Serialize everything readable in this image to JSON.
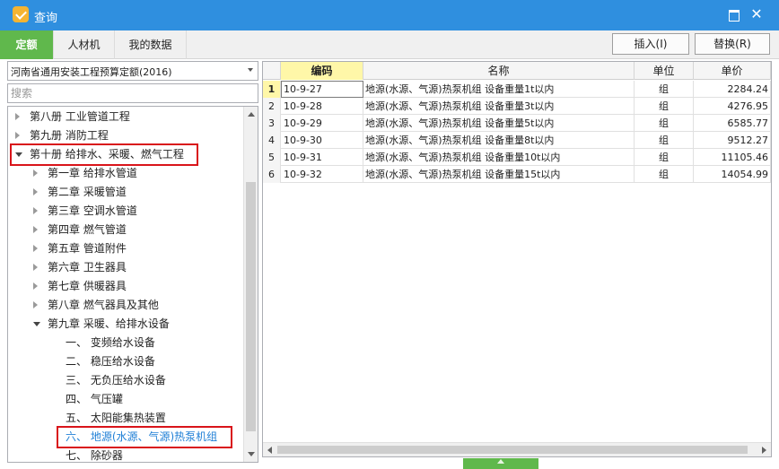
{
  "window": {
    "title": "查询",
    "maximize_glyph": "",
    "close_glyph": "✕",
    "icon": "check-icon",
    "accent_color": "#2f8fdf"
  },
  "tabs": [
    {
      "label": "定额",
      "active": true
    },
    {
      "label": "人材机",
      "active": false
    },
    {
      "label": "我的数据",
      "active": false
    }
  ],
  "toolbar": {
    "insert_label": "插入(I)",
    "replace_label": "替换(R)"
  },
  "left": {
    "dataset": "河南省通用安装工程预算定额(2016)",
    "search_placeholder": "搜索",
    "tree": [
      {
        "label": "第八册 工业管道工程",
        "level": 0,
        "state": "collapsed"
      },
      {
        "label": "第九册 消防工程",
        "level": 0,
        "state": "collapsed"
      },
      {
        "label": "第十册 给排水、采暖、燃气工程",
        "level": 0,
        "state": "expanded",
        "boxed": true
      },
      {
        "label": "第一章 给排水管道",
        "level": 1,
        "state": "collapsed"
      },
      {
        "label": "第二章 采暖管道",
        "level": 1,
        "state": "collapsed"
      },
      {
        "label": "第三章 空调水管道",
        "level": 1,
        "state": "collapsed"
      },
      {
        "label": "第四章 燃气管道",
        "level": 1,
        "state": "collapsed"
      },
      {
        "label": "第五章 管道附件",
        "level": 1,
        "state": "collapsed"
      },
      {
        "label": "第六章 卫生器具",
        "level": 1,
        "state": "collapsed"
      },
      {
        "label": "第七章 供暖器具",
        "level": 1,
        "state": "collapsed"
      },
      {
        "label": "第八章 燃气器具及其他",
        "level": 1,
        "state": "collapsed"
      },
      {
        "label": "第九章 采暖、给排水设备",
        "level": 1,
        "state": "expanded"
      },
      {
        "label": "一、 变频给水设备",
        "level": 2,
        "state": "leaf"
      },
      {
        "label": "二、 稳压给水设备",
        "level": 2,
        "state": "leaf"
      },
      {
        "label": "三、 无负压给水设备",
        "level": 2,
        "state": "leaf"
      },
      {
        "label": "四、 气压罐",
        "level": 2,
        "state": "leaf"
      },
      {
        "label": "五、 太阳能集热装置",
        "level": 2,
        "state": "leaf"
      },
      {
        "label": "六、 地源(水源、气源)热泵机组",
        "level": 2,
        "state": "leaf",
        "boxed": true,
        "selected": true
      },
      {
        "label": "七、 除砂器",
        "level": 2,
        "state": "leaf"
      }
    ]
  },
  "grid": {
    "columns": [
      "编码",
      "名称",
      "单位",
      "单价"
    ],
    "rows": [
      {
        "num": "1",
        "code": "10-9-27",
        "name": "地源(水源、气源)热泵机组 设备重量1t以内",
        "unit": "组",
        "price": "2284.24"
      },
      {
        "num": "2",
        "code": "10-9-28",
        "name": "地源(水源、气源)热泵机组 设备重量3t以内",
        "unit": "组",
        "price": "4276.95"
      },
      {
        "num": "3",
        "code": "10-9-29",
        "name": "地源(水源、气源)热泵机组 设备重量5t以内",
        "unit": "组",
        "price": "6585.77"
      },
      {
        "num": "4",
        "code": "10-9-30",
        "name": "地源(水源、气源)热泵机组 设备重量8t以内",
        "unit": "组",
        "price": "9512.27"
      },
      {
        "num": "5",
        "code": "10-9-31",
        "name": "地源(水源、气源)热泵机组 设备重量10t以内",
        "unit": "组",
        "price": "11105.46"
      },
      {
        "num": "6",
        "code": "10-9-32",
        "name": "地源(水源、气源)热泵机组 设备重量15t以内",
        "unit": "组",
        "price": "14054.99"
      }
    ]
  },
  "colors": {
    "tab_active": "#60b84c",
    "sorted_header": "#fff7a8",
    "highlight_box": "#d9141a",
    "selected_text": "#1f7fd6"
  }
}
